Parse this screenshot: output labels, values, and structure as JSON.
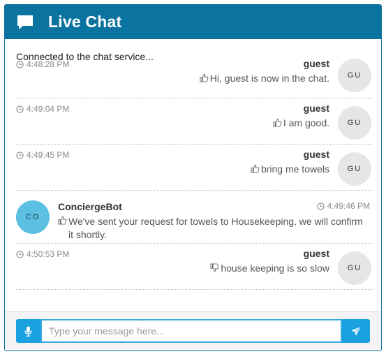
{
  "header": {
    "title": "Live Chat",
    "icon": "chat-bubble-icon",
    "color": "#0b73a0"
  },
  "status_text": "Connected to the chat service...",
  "messages": [
    {
      "time": "4:48:28 PM",
      "sender": "guest",
      "text": "Hi, guest is now in the chat.",
      "avatar": "GU",
      "reaction": "thumbs-up-icon"
    },
    {
      "time": "4:49:04 PM",
      "sender": "guest",
      "text": "I am good.",
      "avatar": "GU",
      "reaction": "thumbs-up-icon"
    },
    {
      "time": "4:49:45 PM",
      "sender": "guest",
      "text": "bring me towels",
      "avatar": "GU",
      "reaction": "thumbs-up-icon"
    },
    {
      "time": "4:49:46 PM",
      "sender": "ConciergeBot",
      "text": "We've sent your request for towels to Housekeeping, we will confirm it shortly.",
      "avatar": "CO",
      "reaction": "thumbs-up-icon"
    },
    {
      "time": "4:50:53 PM",
      "sender": "guest",
      "text": "house keeping is so slow",
      "avatar": "GU",
      "reaction": "thumbs-down-icon"
    }
  ],
  "composer": {
    "placeholder": "Type your message here...",
    "value": "",
    "mic_icon": "microphone-icon",
    "send_icon": "send-icon",
    "button_color": "#1aa1e0"
  }
}
